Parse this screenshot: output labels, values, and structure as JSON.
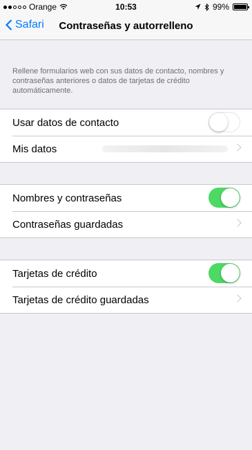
{
  "status_bar": {
    "carrier": "Orange",
    "time": "10:53",
    "battery": "99%",
    "battery_level": 0.99,
    "icons": [
      "signal-dots-icon",
      "wifi-icon",
      "location-arrow-icon",
      "bluetooth-icon",
      "battery-icon"
    ]
  },
  "nav": {
    "back_label": "Safari",
    "title": "Contraseñas y autorrelleno"
  },
  "description": "Rellene formularios web con sus datos de contacto, nombres y contraseñas anteriores o datos de tarjetas de crédito automáticamente.",
  "groups": {
    "contact": {
      "use_contact_label": "Usar datos de contacto",
      "use_contact_on": false,
      "my_info_label": "Mis datos"
    },
    "passwords": {
      "names_passwords_label": "Nombres y contraseñas",
      "names_passwords_on": true,
      "saved_passwords_label": "Contraseñas guardadas"
    },
    "cards": {
      "credit_cards_label": "Tarjetas de crédito",
      "credit_cards_on": true,
      "saved_cards_label": "Tarjetas de crédito guardadas"
    }
  },
  "colors": {
    "accent": "#007aff",
    "toggle_on": "#4cd964",
    "background": "#efeff4"
  }
}
